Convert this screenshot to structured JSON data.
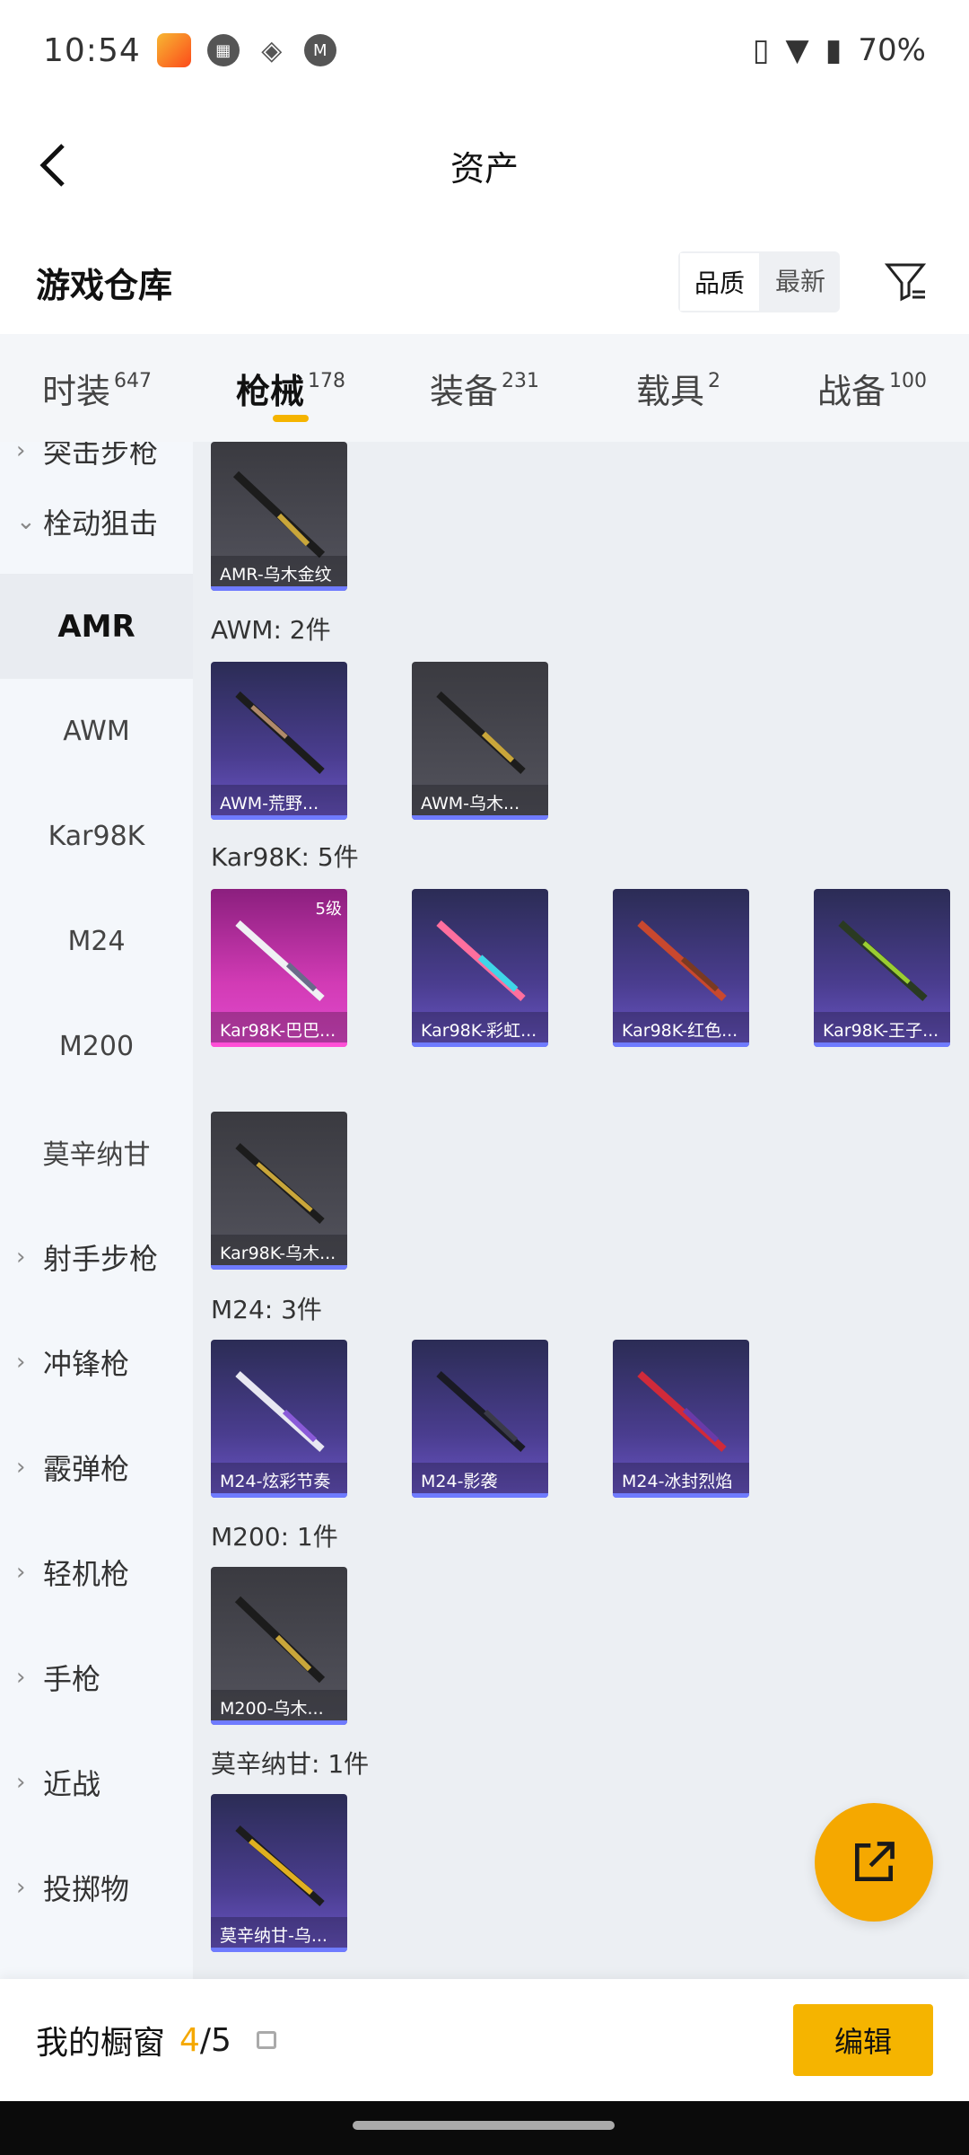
{
  "status": {
    "time": "10:54",
    "battery": "70%"
  },
  "header": {
    "title": "资产"
  },
  "section": {
    "title": "游戏仓库",
    "sort": [
      "品质",
      "最新"
    ]
  },
  "tabs": [
    {
      "label": "时装",
      "count": "647"
    },
    {
      "label": "枪械",
      "count": "178"
    },
    {
      "label": "装备",
      "count": "231"
    },
    {
      "label": "载具",
      "count": "2"
    },
    {
      "label": "战备",
      "count": "100"
    }
  ],
  "sidebar": {
    "top": "突击步枪",
    "expanded": "栓动狙击",
    "subs": [
      "AMR",
      "AWM",
      "Kar98K",
      "M24",
      "M200",
      "莫辛纳甘"
    ],
    "more": [
      "射手步枪",
      "冲锋枪",
      "霰弹枪",
      "轻机枪",
      "手枪",
      "近战",
      "投掷物"
    ]
  },
  "content": {
    "groups": [
      "AWM: 2件",
      "Kar98K: 5件",
      "M24: 3件",
      "M200: 1件",
      "莫辛纳甘: 1件"
    ],
    "cards": [
      {
        "name": "AMR-乌木金纹"
      },
      {
        "name": "AWM-荒野..."
      },
      {
        "name": "AWM-乌木..."
      },
      {
        "name": "Kar98K-巴巴...",
        "level": "5级"
      },
      {
        "name": "Kar98K-彩虹..."
      },
      {
        "name": "Kar98K-红色..."
      },
      {
        "name": "Kar98K-王子..."
      },
      {
        "name": "Kar98K-乌木..."
      },
      {
        "name": "M24-炫彩节奏"
      },
      {
        "name": "M24-影袭"
      },
      {
        "name": "M24-冰封烈焰"
      },
      {
        "name": "M200-乌木..."
      },
      {
        "name": "莫辛纳甘-乌..."
      }
    ]
  },
  "bottom": {
    "label": "我的橱窗",
    "current": "4",
    "total": "/5",
    "edit": "编辑"
  }
}
